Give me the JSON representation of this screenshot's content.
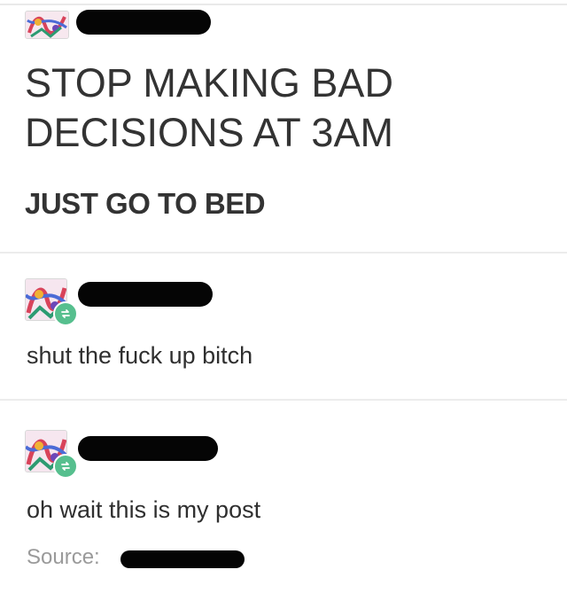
{
  "original_post": {
    "title_line_1": "STOP MAKING BAD",
    "title_line_2": "DECISIONS AT 3AM",
    "subtitle": "JUST GO TO BED",
    "avatar_icon": "keith-haring-style-art-icon"
  },
  "reblogs": [
    {
      "text": "shut the fuck up bitch",
      "avatar_icon": "keith-haring-style-art-icon",
      "badge_icon": "reblog-icon"
    },
    {
      "text": "oh wait this is my post",
      "avatar_icon": "keith-haring-style-art-icon",
      "badge_icon": "reblog-icon"
    }
  ],
  "footer": {
    "source_label": "Source:"
  },
  "colors": {
    "reblog_badge": "#56bf8e",
    "text": "#333333",
    "muted": "#9a9a9a",
    "redaction": "#050505"
  }
}
